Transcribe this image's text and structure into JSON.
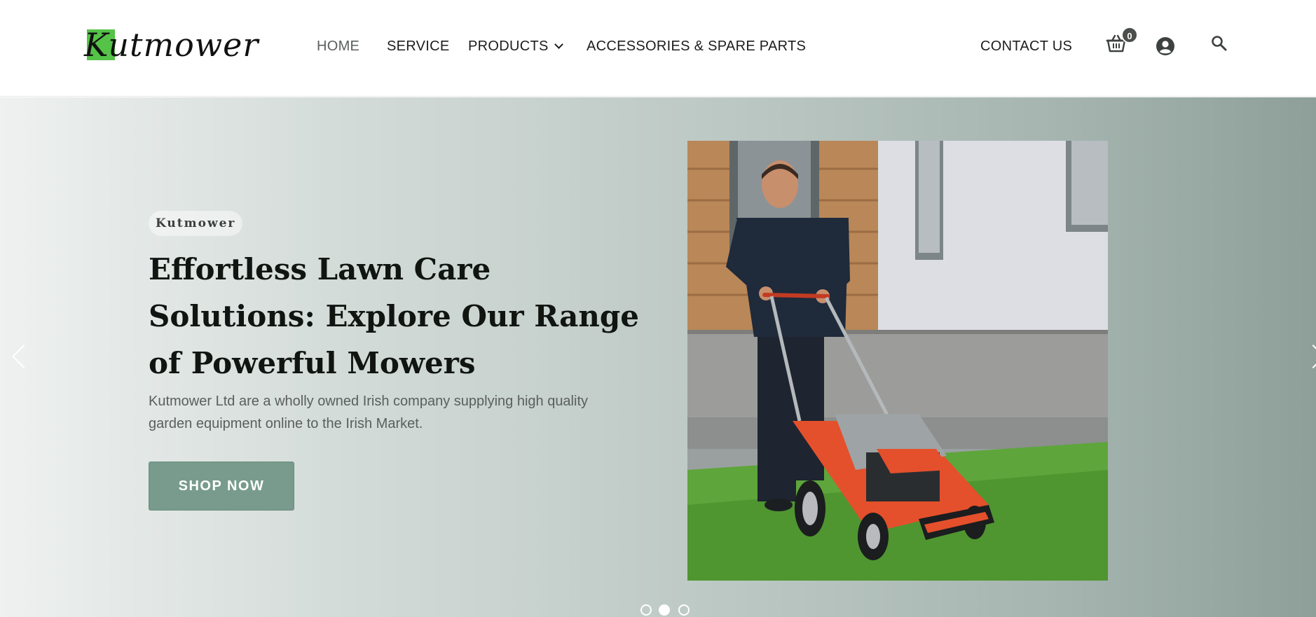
{
  "header": {
    "logo_text": "Kutmower",
    "nav": [
      {
        "label": "HOME",
        "active": true
      },
      {
        "label": "SERVICE",
        "active": false
      },
      {
        "label": "PRODUCTS",
        "active": false,
        "has_dropdown": true
      },
      {
        "label": "ACCESSORIES & SPARE PARTS",
        "active": false
      }
    ],
    "contact_label": "CONTACT US",
    "cart_count": "0",
    "icons": [
      "basket-icon",
      "user-account-icon",
      "search-icon"
    ]
  },
  "hero": {
    "eyebrow": "Kutmower",
    "headline": "Effortless Lawn Care Solutions: Explore Our Range of Powerful Mowers",
    "subtext": "Kutmower Ltd are a wholly owned Irish company supplying high quality garden equipment online to the Irish Market.",
    "cta_label": "SHOP NOW",
    "image_subject": "man-mowing-lawn-photo",
    "slides_total": 3,
    "active_slide": 2
  },
  "colors": {
    "brand_green": "#55c248",
    "button": "#789b8d",
    "text_dark": "#111511",
    "text_muted": "#5a5f5c",
    "mower_orange": "#e4502b"
  }
}
